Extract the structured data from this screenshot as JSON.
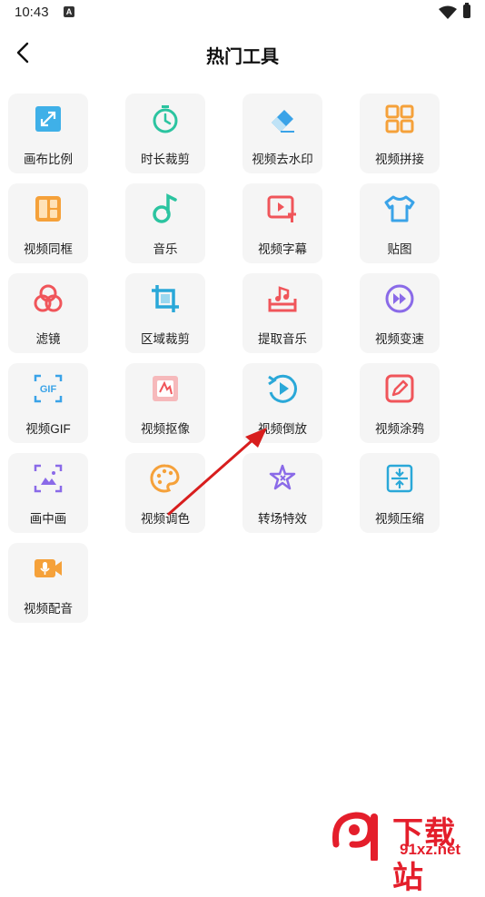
{
  "status_bar": {
    "time": "10:43",
    "notification_glyph": "A"
  },
  "header": {
    "title": "热门工具",
    "back_icon": "chevron-left-icon"
  },
  "tools": [
    {
      "label": "画布比例",
      "icon": "canvas-ratio-icon",
      "color": "#3fb0e8"
    },
    {
      "label": "时长裁剪",
      "icon": "stopwatch-icon",
      "color": "#2bc4a0"
    },
    {
      "label": "视频去水印",
      "icon": "eraser-icon",
      "color": "#3aa3e8"
    },
    {
      "label": "视频拼接",
      "icon": "grid-splice-icon",
      "color": "#f5a13a"
    },
    {
      "label": "视频同框",
      "icon": "split-frame-icon",
      "color": "#f5a13a"
    },
    {
      "label": "音乐",
      "icon": "music-note-icon",
      "color": "#2bc4a0"
    },
    {
      "label": "视频字幕",
      "icon": "subtitle-icon",
      "color": "#f0555a"
    },
    {
      "label": "贴图",
      "icon": "shirt-sticker-icon",
      "color": "#3aa3e8"
    },
    {
      "label": "滤镜",
      "icon": "filter-circles-icon",
      "color": "#f0555a"
    },
    {
      "label": "区域裁剪",
      "icon": "crop-icon",
      "color": "#2aa8d8"
    },
    {
      "label": "提取音乐",
      "icon": "extract-music-icon",
      "color": "#f0555a"
    },
    {
      "label": "视频变速",
      "icon": "fast-forward-icon",
      "color": "#8a6ae8"
    },
    {
      "label": "视频GIF",
      "icon": "gif-icon",
      "color": "#3aa3e8"
    },
    {
      "label": "视频抠像",
      "icon": "cutout-icon",
      "color": "#f0555a"
    },
    {
      "label": "视频倒放",
      "icon": "reverse-play-icon",
      "color": "#2aa8d8"
    },
    {
      "label": "视频涂鸦",
      "icon": "doodle-pen-icon",
      "color": "#f0555a"
    },
    {
      "label": "画中画",
      "icon": "picture-in-picture-icon",
      "color": "#8a6ae8"
    },
    {
      "label": "视频调色",
      "icon": "palette-icon",
      "color": "#f5a13a"
    },
    {
      "label": "转场特效",
      "icon": "sparkle-star-icon",
      "color": "#8a6ae8"
    },
    {
      "label": "视频压缩",
      "icon": "compress-icon",
      "color": "#2aa8d8"
    },
    {
      "label": "视频配音",
      "icon": "dubbing-camera-icon",
      "color": "#f5a13a"
    }
  ],
  "annotation": {
    "arrow_color": "#d81e1e"
  },
  "watermark": {
    "title": "下载站",
    "url": "91xz.net",
    "logo_color": "#e41e2b"
  }
}
